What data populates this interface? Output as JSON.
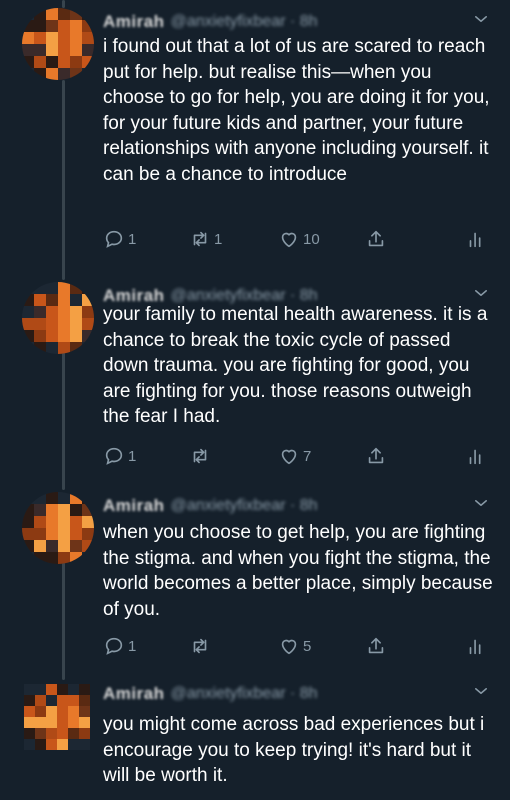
{
  "tweets": [
    {
      "author": "Amirah",
      "handle": "@anxietyfixbear · 8h",
      "text": "i found out that a lot of us are scared to reach put for help. but realise this—when you choose to go for help, you are doing it for you, for your future kids and partner, your future relationships with anyone including yourself. it can be a chance to introduce",
      "replies": "1",
      "retweets": "1",
      "likes": "10"
    },
    {
      "author": "Amirah",
      "handle": "@anxietyfixbear · 8h",
      "text": "your family to mental health awareness. it is a chance to break the toxic cycle of passed down trauma. you are fighting for good, you are fighting for you. those reasons outweigh the fear I had.",
      "replies": "1",
      "retweets": "",
      "likes": "7"
    },
    {
      "author": "Amirah",
      "handle": "@anxietyfixbear · 8h",
      "text": "when you choose to get help, you are fighting the stigma. and when you fight the stigma, the world becomes a better place, simply because of you.",
      "replies": "1",
      "retweets": "",
      "likes": "5"
    },
    {
      "author": "Amirah",
      "handle": "@anxietyfixbear · 8h",
      "text": "you might come across bad experiences but i encourage you to keep trying! it's hard but it will be worth it."
    }
  ],
  "colors": {
    "background": "#15202b",
    "muted": "#8899a6",
    "thread_line": "#38444d",
    "text": "#ffffff"
  },
  "icons": [
    "reply-icon",
    "retweet-icon",
    "like-icon",
    "share-icon",
    "analytics-icon",
    "chevron-down-icon"
  ]
}
